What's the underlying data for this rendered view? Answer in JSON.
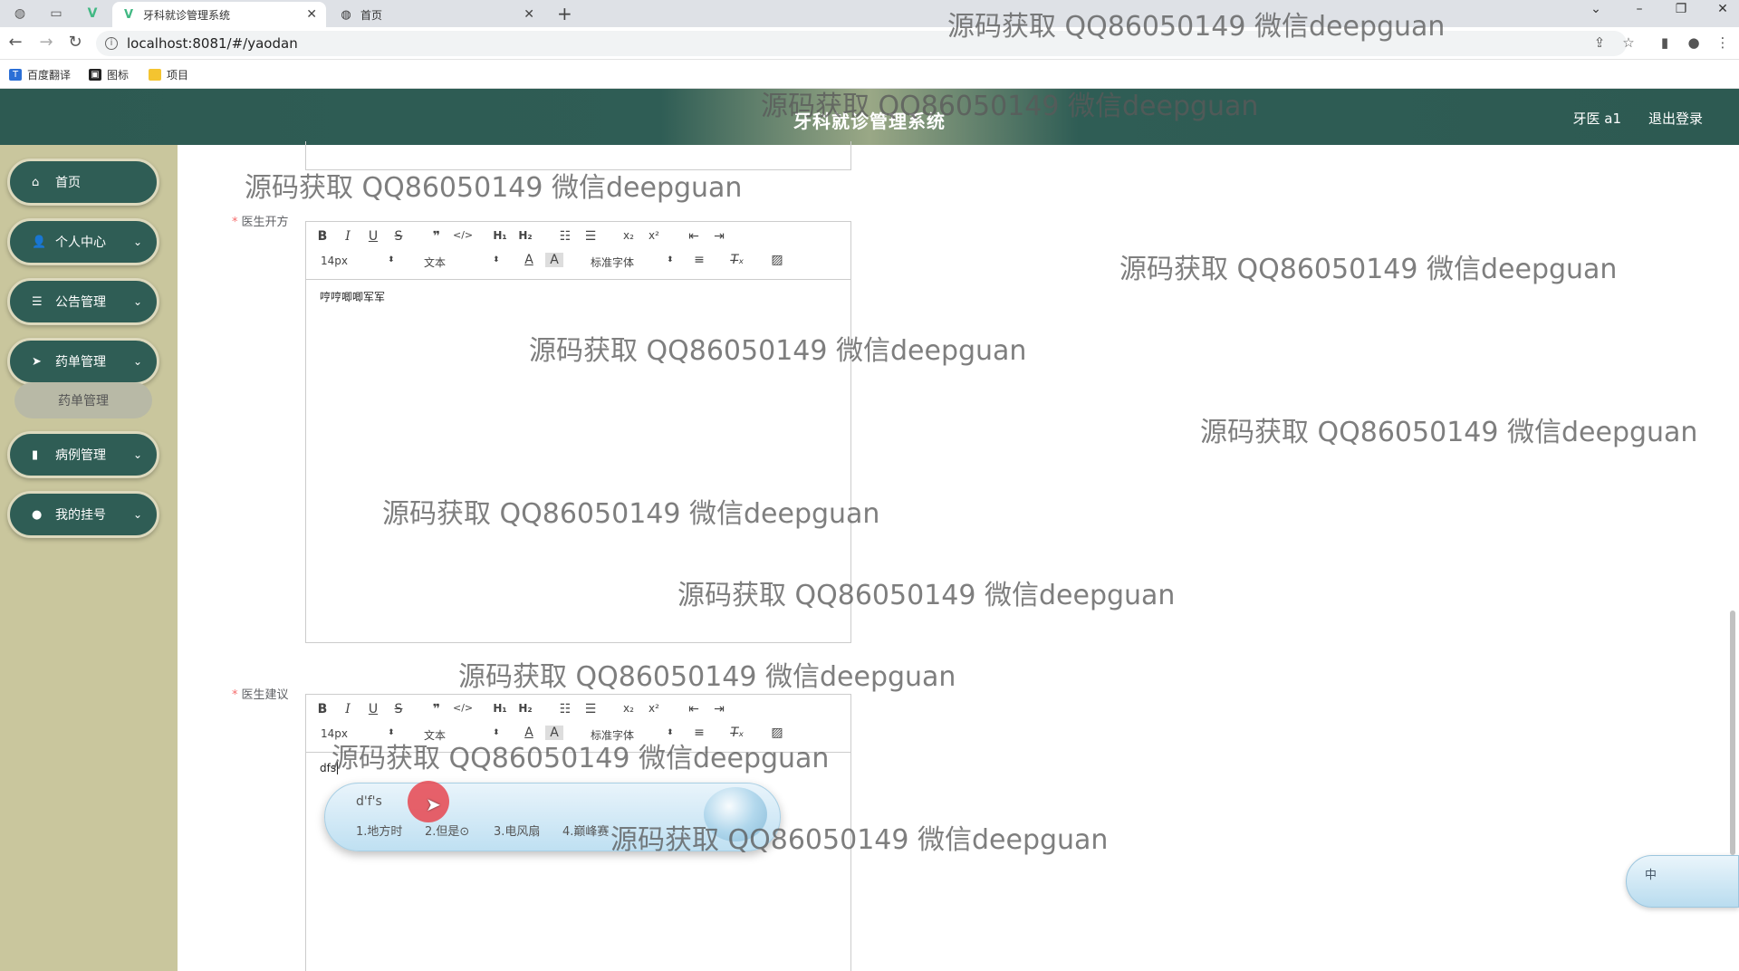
{
  "browser": {
    "tabs": [
      {
        "title": "牙科就诊管理系统",
        "active": true
      },
      {
        "title": "首页",
        "active": false
      }
    ],
    "url": "localhost:8081/#/yaodan",
    "bookmarks": [
      "百度翻译",
      "图标",
      "项目"
    ]
  },
  "header": {
    "title": "牙科就诊管理系统",
    "user": "牙医 a1",
    "logout": "退出登录"
  },
  "sidebar": {
    "items": [
      {
        "label": "首页",
        "icon": "home-icon",
        "expandable": false
      },
      {
        "label": "个人中心",
        "icon": "user-icon",
        "expandable": true
      },
      {
        "label": "公告管理",
        "icon": "list-icon",
        "expandable": true
      },
      {
        "label": "药单管理",
        "icon": "send-icon",
        "expandable": true
      },
      {
        "label": "病例管理",
        "icon": "bar-chart-icon",
        "expandable": true
      },
      {
        "label": "我的挂号",
        "icon": "pin-icon",
        "expandable": true
      }
    ],
    "submenu": {
      "label": "药单管理"
    }
  },
  "form": {
    "prescription": {
      "label": "医生开方",
      "content": "哼哼唧唧军军",
      "toolbar": {
        "font_size": "14px",
        "format": "文本",
        "font": "标准字体"
      }
    },
    "advice": {
      "label": "医生建议",
      "content": "dfs",
      "toolbar": {
        "font_size": "14px",
        "format": "文本",
        "font": "标准字体"
      }
    }
  },
  "ime": {
    "input": "d'f's",
    "candidates": [
      "1.地方时",
      "2.但是⊙",
      "3.电风扇",
      "4.巅峰赛"
    ],
    "status": "中"
  },
  "watermark": {
    "text": "源码获取 QQ86050149 微信deepguan"
  }
}
